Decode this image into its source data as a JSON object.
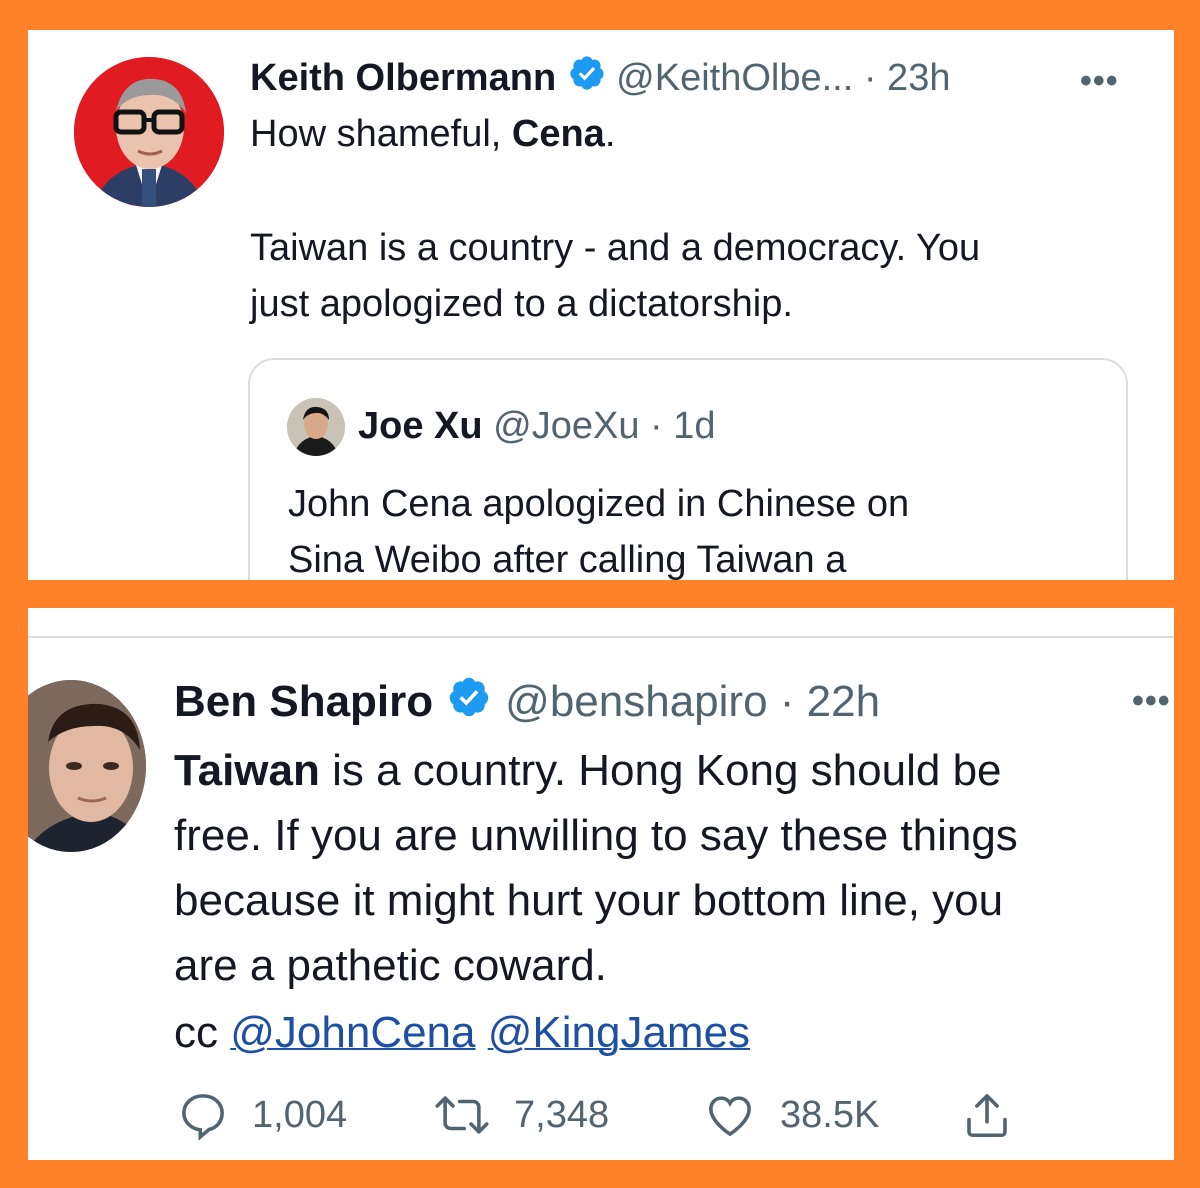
{
  "colors": {
    "frame": "#ff8128",
    "verified": "#1d9bf0",
    "text": "#141823",
    "muted": "#536471",
    "mention": "#1d4fa3"
  },
  "tweet_top": {
    "author_name": "Keith Olbermann",
    "handle_time": "@KeithOlbe... · 23h",
    "more_icon": "more-dots-icon",
    "line1_prefix": "How shameful, ",
    "line1_bold": "Cena",
    "line1_suffix": ".",
    "body_line1": "Taiwan is a country - and a democracy. You",
    "body_line2": "just apologized to a dictatorship.",
    "quote": {
      "author_name": "Joe Xu",
      "handle_time": "@JoeXu · 1d",
      "text_line1": "John Cena apologized in Chinese on",
      "text_line2": "Sina Weibo after calling Taiwan a"
    }
  },
  "tweet_bottom": {
    "author_name": "Ben Shapiro",
    "handle_time": "@benshapiro · 22h",
    "more_icon": "more-dots-icon",
    "body_bold": "Taiwan",
    "body_line1_rest": " is a country. Hong Kong should be",
    "body_line2": "free. If you are unwilling to say these things",
    "body_line3": "because it might hurt your bottom line, you",
    "body_line4": "are a pathetic coward.",
    "cc_label": "cc ",
    "mentions": [
      "@JohnCena",
      "@KingJames"
    ],
    "replies": "1,004",
    "retweets": "7,348",
    "likes": "38.5K"
  }
}
